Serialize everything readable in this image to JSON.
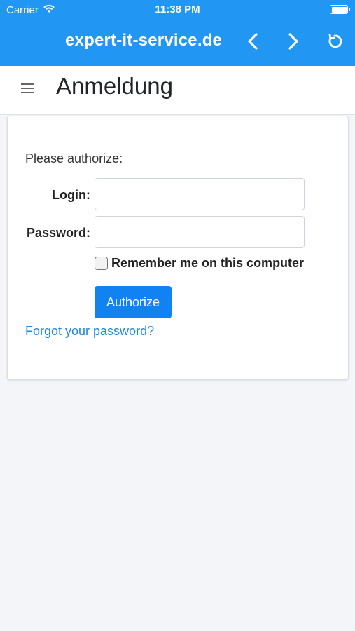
{
  "status_bar": {
    "carrier": "Carrier",
    "time": "11:38 PM"
  },
  "browser": {
    "domain": "expert-it-service.de",
    "icons": [
      "chevron-left-icon",
      "chevron-right-icon",
      "reload-icon",
      "wifi-icon",
      "battery-icon"
    ]
  },
  "header": {
    "title": "Anmeldung",
    "menu_icon": "hamburger-menu-icon"
  },
  "login_form": {
    "intro": "Please authorize:",
    "login_label": "Login:",
    "login_value": "",
    "password_label": "Password:",
    "password_value": "",
    "remember_label": "Remember me on this computer",
    "remember_checked": false,
    "submit_label": "Authorize",
    "forgot_link": "Forgot your password?"
  },
  "colors": {
    "accent": "#2196f3",
    "button": "#1082f2",
    "link": "#1e88e5",
    "background": "#f3f5f8"
  }
}
